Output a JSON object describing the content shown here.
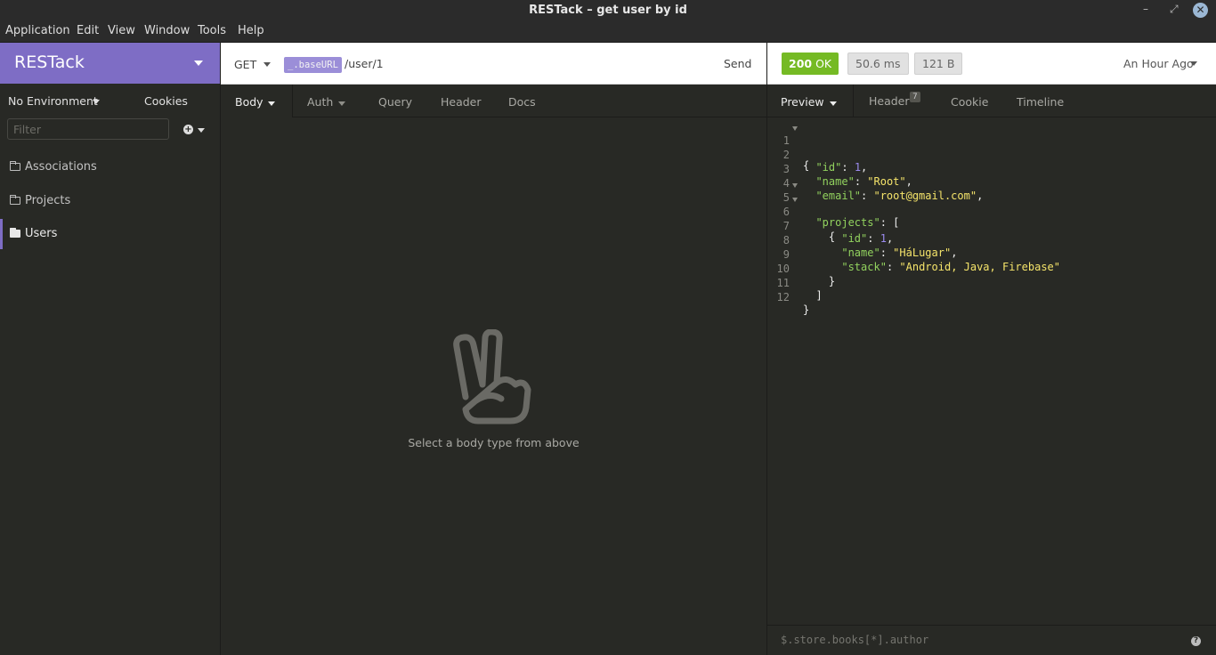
{
  "window": {
    "title": "RESTack – get user by id",
    "minimize": "–",
    "maximize": "⤢",
    "close": "✕"
  },
  "menu": {
    "items": [
      "Application",
      "Edit",
      "View",
      "Window",
      "Tools",
      "Help"
    ]
  },
  "sidebar": {
    "workspace": "RESTack",
    "environment": "No Environment",
    "cookies": "Cookies",
    "filter_placeholder": "Filter",
    "add_glyph": "+",
    "folders": [
      {
        "label": "Associations",
        "active": false
      },
      {
        "label": "Projects",
        "active": false
      },
      {
        "label": "Users",
        "active": true
      }
    ],
    "accent_color": "#7e6dc5"
  },
  "request": {
    "method": "GET",
    "url_variable": "_.baseURL",
    "url_path": "/user/1",
    "send_label": "Send",
    "tabs": [
      "Body",
      "Auth",
      "Query",
      "Header",
      "Docs"
    ],
    "active_tab": "Body",
    "empty_message": "Select a body type from above",
    "empty_icon": "peace-hand-icon"
  },
  "response": {
    "status": "200",
    "status_text": "OK",
    "status_color": "#75ba24",
    "time": "50.6 ms",
    "size": "121 B",
    "when": "An Hour Ago",
    "tabs": [
      "Preview",
      "Header",
      "Cookie",
      "Timeline"
    ],
    "header_count": "7",
    "active_tab": "Preview",
    "filter_placeholder": "$.store.books[*].author",
    "help_glyph": "?",
    "body_lines": [
      {
        "n": "1",
        "fold": true
      },
      {
        "n": "2",
        "fold": false
      },
      {
        "n": "3",
        "fold": false
      },
      {
        "n": "4",
        "fold": false
      },
      {
        "n": "5",
        "fold": true
      },
      {
        "n": "6",
        "fold": true
      },
      {
        "n": "7",
        "fold": false
      },
      {
        "n": "8",
        "fold": false
      },
      {
        "n": "9",
        "fold": false
      },
      {
        "n": "10",
        "fold": false
      },
      {
        "n": "11",
        "fold": false
      },
      {
        "n": "12",
        "fold": false
      }
    ],
    "json": {
      "id_key": "\"id\"",
      "id_val": "1",
      "name_key": "\"name\"",
      "name_val": "\"Root\"",
      "email_key": "\"email\"",
      "email_val": "\"root@gmail.com\"",
      "projects_key": "\"projects\"",
      "p_id_key": "\"id\"",
      "p_id_val": "1",
      "p_name_key": "\"name\"",
      "p_name_val": "\"HáLugar\"",
      "p_stack_key": "\"stack\"",
      "p_stack_val": "\"Android, Java, Firebase\""
    }
  }
}
